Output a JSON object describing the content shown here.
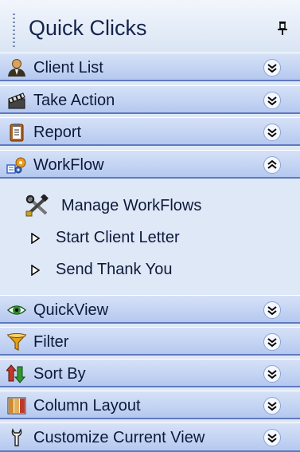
{
  "panel": {
    "title": "Quick Clicks"
  },
  "sections": [
    {
      "label": "Client List",
      "icon": "person-icon",
      "expanded": false
    },
    {
      "label": "Take Action",
      "icon": "clapperboard-icon",
      "expanded": false
    },
    {
      "label": "Report",
      "icon": "clipboard-icon",
      "expanded": false
    },
    {
      "label": "WorkFlow",
      "icon": "workflow-gears-icon",
      "expanded": true
    },
    {
      "label": "QuickView",
      "icon": "eye-icon",
      "expanded": false
    },
    {
      "label": "Filter",
      "icon": "funnel-icon",
      "expanded": false
    },
    {
      "label": "Sort By",
      "icon": "sort-arrows-icon",
      "expanded": false
    },
    {
      "label": "Column Layout",
      "icon": "columns-icon",
      "expanded": false
    },
    {
      "label": "Customize Current View",
      "icon": "wrench-icon",
      "expanded": false
    }
  ],
  "workflow_items": [
    {
      "label": "Manage WorkFlows",
      "icon": "tools-icon"
    },
    {
      "label": "Start Client Letter",
      "icon": "play-triangle-icon"
    },
    {
      "label": "Send Thank You",
      "icon": "play-triangle-icon"
    }
  ],
  "colors": {
    "panel_background": "#dfe8f6",
    "section_border": "#5f79c0",
    "text": "#0e1a3c"
  }
}
